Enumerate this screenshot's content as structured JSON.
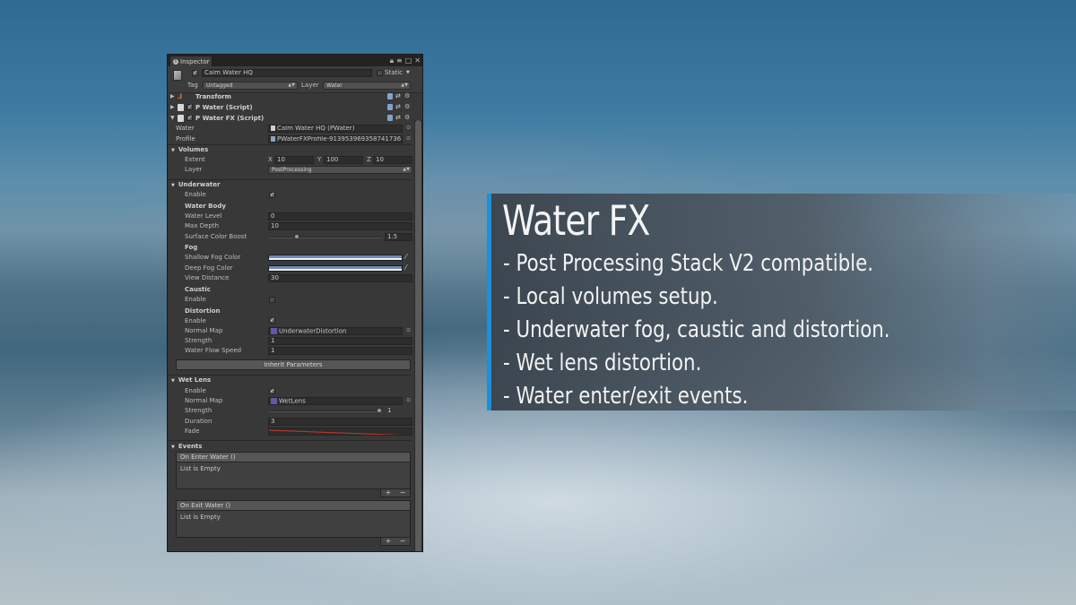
{
  "inspector": {
    "tab_label": "Inspector",
    "object": {
      "name": "Calm Water HQ",
      "static_label": "Static",
      "tag_label": "Tag",
      "tag_value": "Untagged",
      "layer_label": "Layer",
      "layer_value": "Water"
    },
    "components": [
      {
        "name": "Transform"
      },
      {
        "name": "P Water (Script)"
      },
      {
        "name": "P Water FX (Script)"
      }
    ],
    "water_label": "Water",
    "water_value": "Calm Water HQ (PWater)",
    "profile_label": "Profile",
    "profile_value": "PWaterFXProfile-913953969358741736",
    "volumes": {
      "title": "Volumes",
      "extent_label": "Extent",
      "x_label": "X",
      "x_value": "10",
      "y_label": "Y",
      "y_value": "100",
      "z_label": "Z",
      "z_value": "10",
      "layer_label": "Layer",
      "layer_value": "PostProcessing"
    },
    "underwater": {
      "title": "Underwater",
      "enable_label": "Enable",
      "water_body_title": "Water Body",
      "water_level_label": "Water Level",
      "water_level_value": "0",
      "max_depth_label": "Max Depth",
      "max_depth_value": "10",
      "surface_color_boost_label": "Surface Color Boost",
      "surface_color_boost_value": "1.5",
      "fog_title": "Fog",
      "shallow_fog_label": "Shallow Fog Color",
      "deep_fog_label": "Deep Fog Color",
      "view_distance_label": "View Distance",
      "view_distance_value": "30",
      "caustic_title": "Caustic",
      "caustic_enable_label": "Enable",
      "distortion_title": "Distortion",
      "distortion_enable_label": "Enable",
      "normal_map_label": "Normal Map",
      "normal_map_value": "UnderwaterDistortion",
      "strength_label": "Strength",
      "strength_value": "1",
      "flow_speed_label": "Water Flow Speed",
      "flow_speed_value": "1",
      "inherit_button": "Inherit Parameters"
    },
    "wet_lens": {
      "title": "Wet Lens",
      "enable_label": "Enable",
      "normal_map_label": "Normal Map",
      "normal_map_value": "WetLens",
      "strength_label": "Strength",
      "strength_value": "1",
      "duration_label": "Duration",
      "duration_value": "3",
      "fade_label": "Fade"
    },
    "events": {
      "title": "Events",
      "on_enter": "On Enter Water ()",
      "on_exit": "On Exit Water ()",
      "empty_text": "List is Empty",
      "plus": "+",
      "minus": "−"
    }
  },
  "feature_panel": {
    "title": "Water FX",
    "items": [
      "- Post Processing Stack V2 compatible.",
      "- Local volumes setup.",
      "- Underwater fog, caustic and distortion.",
      "- Wet lens distortion.",
      "- Water enter/exit events."
    ],
    "accent_color": "#1f8fd8"
  },
  "colors": {
    "shallow_fog": "#6f89b9",
    "deep_fog": "#6f89b9",
    "fade_curve": "#c0392b"
  }
}
